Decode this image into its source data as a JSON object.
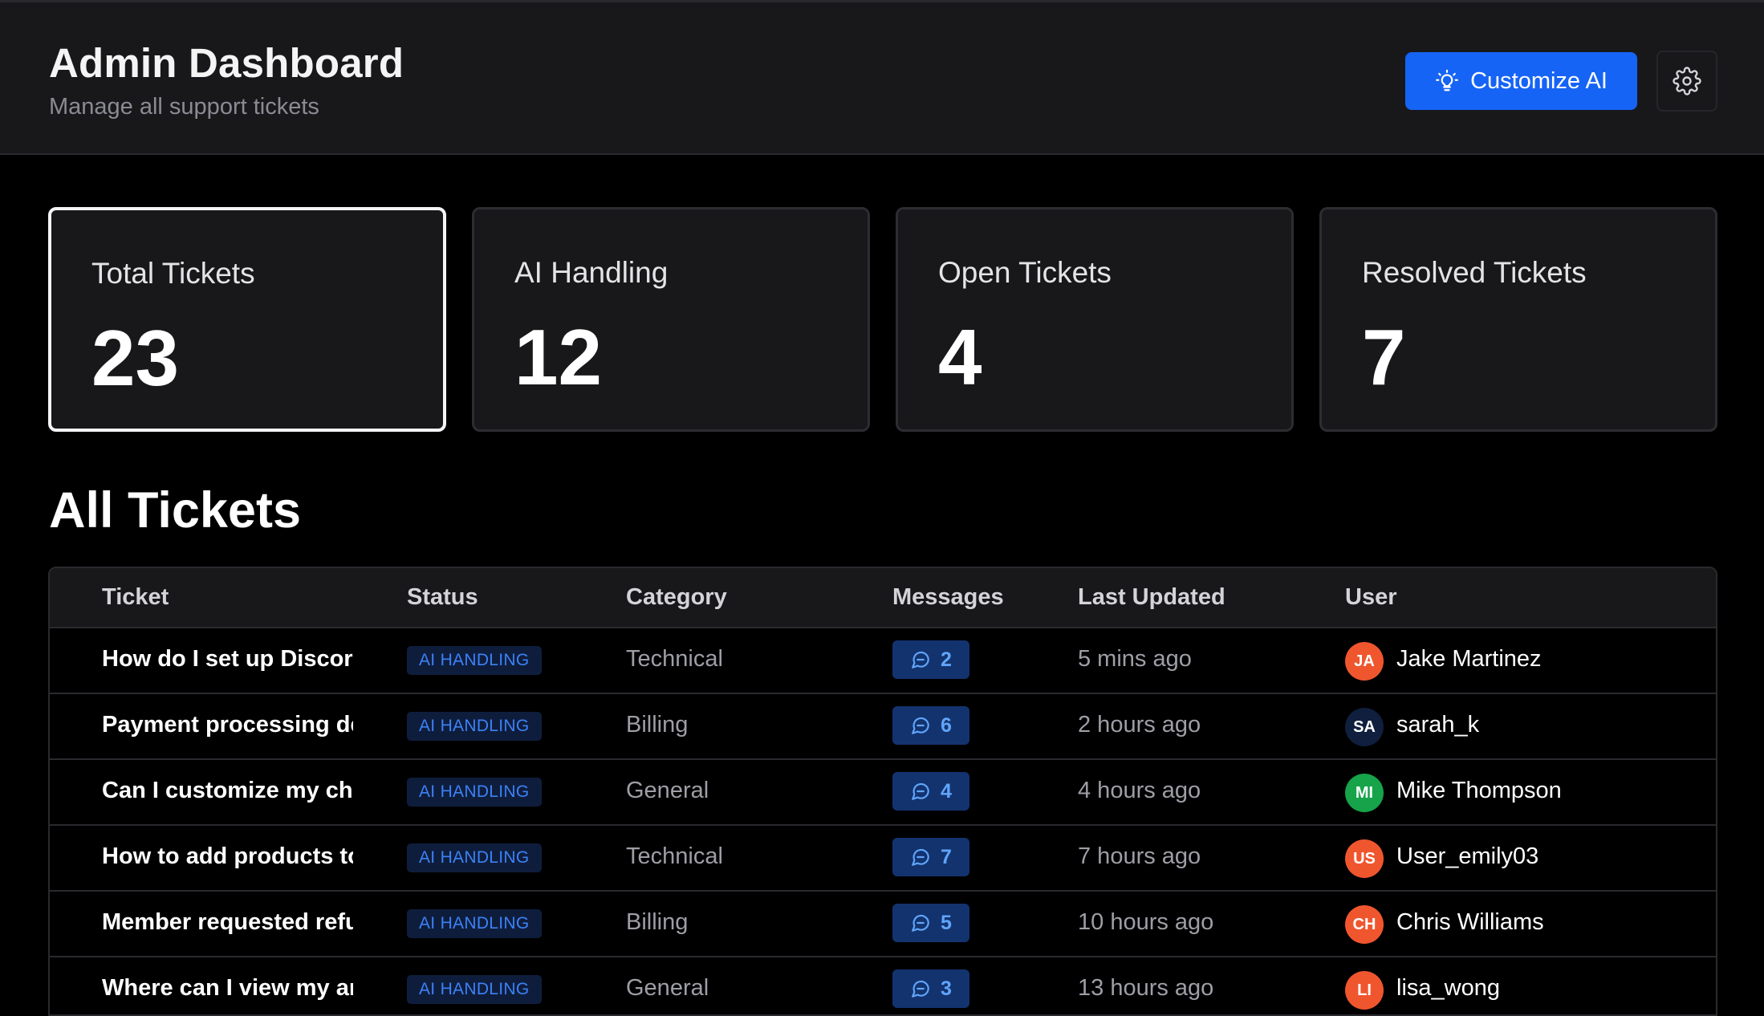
{
  "header": {
    "title": "Admin Dashboard",
    "subtitle": "Manage all support tickets",
    "customize_label": "Customize AI",
    "customize_icon": "lightbulb-icon",
    "settings_icon": "gear-icon"
  },
  "stats": [
    {
      "label": "Total Tickets",
      "value": "23"
    },
    {
      "label": "AI Handling",
      "value": "12"
    },
    {
      "label": "Open Tickets",
      "value": "4"
    },
    {
      "label": "Resolved Tickets",
      "value": "7"
    }
  ],
  "tickets_section": {
    "title": "All Tickets",
    "columns": [
      "Ticket",
      "Status",
      "Category",
      "Messages",
      "Last Updated",
      "User"
    ],
    "rows": [
      {
        "ticket": "How do I set up Discord roles",
        "status": "AI HANDLING",
        "category": "Technical",
        "messages": "2",
        "updated": "5 mins ago",
        "initials": "JA",
        "user": "Jake Martinez",
        "avatar_color": "#f0562e"
      },
      {
        "ticket": "Payment processing delay",
        "status": "AI HANDLING",
        "category": "Billing",
        "messages": "6",
        "updated": "2 hours ago",
        "initials": "SA",
        "user": "sarah_k",
        "avatar_color": "#0f1f3d"
      },
      {
        "ticket": "Can I customize my checkout",
        "status": "AI HANDLING",
        "category": "General",
        "messages": "4",
        "updated": "4 hours ago",
        "initials": "MI",
        "user": "Mike Thompson",
        "avatar_color": "#16a34a"
      },
      {
        "ticket": "How to add products to my",
        "status": "AI HANDLING",
        "category": "Technical",
        "messages": "7",
        "updated": "7 hours ago",
        "initials": "US",
        "user": "User_emily03",
        "avatar_color": "#f0562e"
      },
      {
        "ticket": "Member requested refund",
        "status": "AI HANDLING",
        "category": "Billing",
        "messages": "5",
        "updated": "10 hours ago",
        "initials": "CH",
        "user": "Chris Williams",
        "avatar_color": "#f0562e"
      },
      {
        "ticket": "Where can I view my analytics",
        "status": "AI HANDLING",
        "category": "General",
        "messages": "3",
        "updated": "13 hours ago",
        "initials": "LI",
        "user": "lisa_wong",
        "avatar_color": "#f0562e"
      }
    ]
  },
  "colors": {
    "accent": "#1664f5",
    "status_text": "#3b82f6",
    "background": "#000000",
    "panel": "#18181b"
  }
}
